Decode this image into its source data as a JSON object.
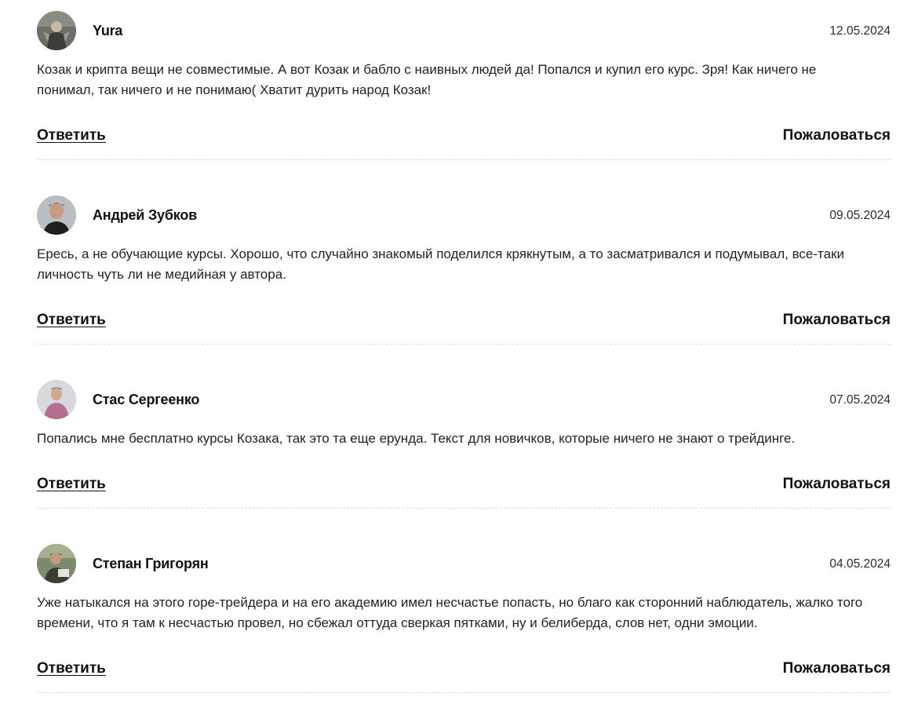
{
  "comments": [
    {
      "author": "Yura",
      "date": "12.05.2024",
      "text": "Козак и крипта вещи не совместимые. А вот Козак и бабло с наивных людей да! Попался и купил его курс. Зря! Как ничего не понимал, так ничего и не понимаю( Хватит дурить народ Козак!",
      "reply_label": "Ответить",
      "report_label": "Пожаловаться",
      "avatar_colors": {
        "bg": "#6b6f66",
        "fg": "#d9d2c4"
      }
    },
    {
      "author": "Андрей Зубков",
      "date": "09.05.2024",
      "text": "Ересь, а не обучающие курсы. Хорошо, что случайно знакомый поделился крякнутым, а то засматривался и подумывал, все-таки личность чуть ли не медийная у автора.",
      "reply_label": "Ответить",
      "report_label": "Пожаловаться",
      "avatar_colors": {
        "bg": "#b9bec4",
        "fg": "#2a2a2a"
      }
    },
    {
      "author": "Стас Сергеенко",
      "date": "07.05.2024",
      "text": "Попались мне бесплатно курсы Козака, так это та еще ерунда. Текст для новичков, которые ничего не знают о трейдинге.",
      "reply_label": "Ответить",
      "report_label": "Пожаловаться",
      "avatar_colors": {
        "bg": "#d7d9dc",
        "fg": "#b46d8e"
      }
    },
    {
      "author": "Степан Григорян",
      "date": "04.05.2024",
      "text": "Уже натыкался на этого горе-трейдера и на его академию имел несчастье попасть, но благо как сторонний наблюдатель, жалко того времени, что я там к несчастью провел, но сбежал оттуда сверкая пятками, ну и белиберда, слов нет, одни эмоции.",
      "reply_label": "Ответить",
      "report_label": "Пожаловаться",
      "avatar_colors": {
        "bg": "#7c8a6e",
        "fg": "#3a3f35"
      }
    }
  ]
}
